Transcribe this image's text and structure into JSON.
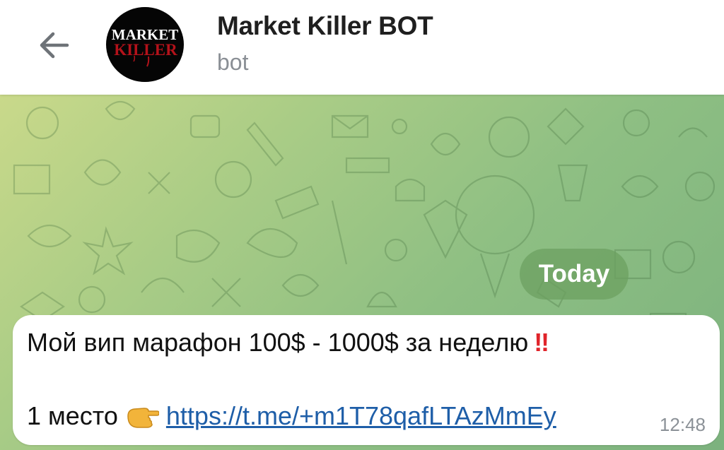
{
  "header": {
    "title": "Market Killer BOT",
    "subtitle": "bot",
    "avatar": {
      "logo_line1": "MARKET",
      "logo_line2": "KILLER"
    }
  },
  "chat": {
    "date_label": "Today",
    "message": {
      "line1_text": "Мой вип марафон 100$ - 1000$ за неделю",
      "line1_emoji": "‼",
      "line2_prefix": "1 место",
      "line2_emoji_icon": "pointing-hand-icon",
      "link_text": "https://t.me/+m1T78qafLTAzMmEy",
      "time": "12:48"
    }
  },
  "colors": {
    "header_bg": "#ffffff",
    "title": "#1f1f1f",
    "subtitle": "#8a8f95",
    "chat_bg_start": "#c9d98a",
    "chat_bg_end": "#7cb27e",
    "date_pill": "#6ca060",
    "bubble": "#ffffff",
    "link": "#1e5ea8",
    "alert_red": "#e0242a"
  }
}
